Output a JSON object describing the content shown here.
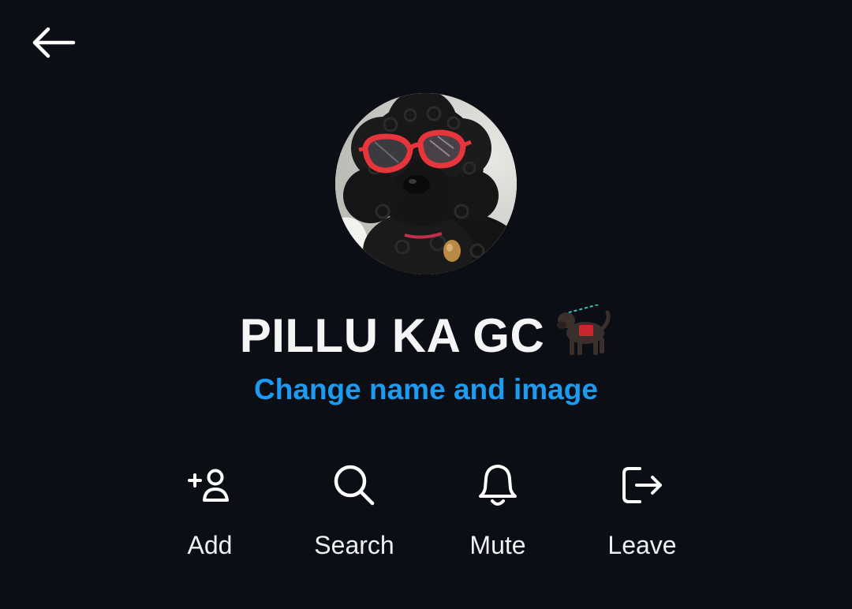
{
  "header": {
    "back_icon": "arrow-left-icon"
  },
  "group": {
    "avatar_description_icon": "group-avatar",
    "name": "PILLU KA GC",
    "name_emoji": "service-dog-emoji",
    "change_link": "Change name and image"
  },
  "actions": [
    {
      "label": "Add",
      "icon": "add-person-icon"
    },
    {
      "label": "Search",
      "icon": "search-icon"
    },
    {
      "label": "Mute",
      "icon": "bell-icon"
    },
    {
      "label": "Leave",
      "icon": "leave-icon"
    }
  ],
  "colors": {
    "background": "#0b0e14",
    "accent": "#1d9bf0",
    "text": "#f3f4f6"
  }
}
